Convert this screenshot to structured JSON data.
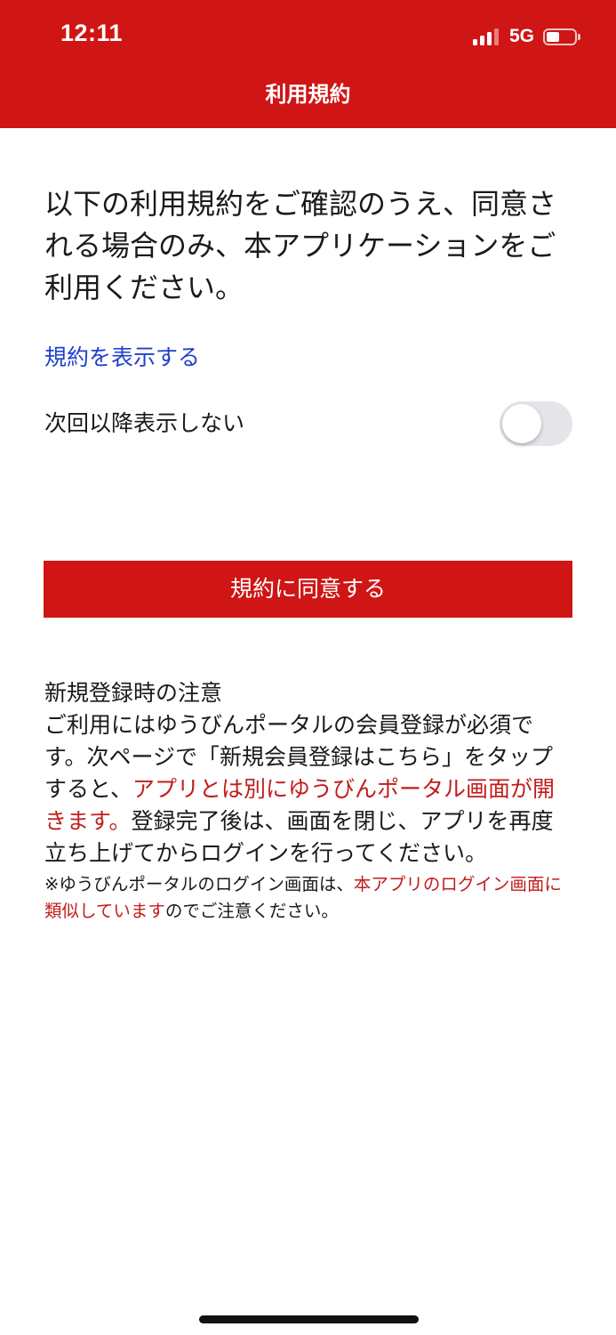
{
  "status_bar": {
    "time": "12:11",
    "network": "5G",
    "signal_bars": 3,
    "signal_bars_total": 4
  },
  "nav": {
    "title": "利用規約"
  },
  "intro_text": "以下の利用規約をご確認のうえ、同意される場合のみ、本アプリケーションをご利用ください。",
  "terms_link": "規約を表示する",
  "dont_show_again": {
    "label": "次回以降表示しない",
    "enabled": false
  },
  "agree_button": "規約に同意する",
  "notice": {
    "title": "新規登録時の注意",
    "body_1": "ご利用にはゆうびんポータルの会員登録が必須です。次ページで「新規会員登録はこちら」をタップすると、",
    "body_red": "アプリとは別にゆうびんポータル画面が開きます。",
    "body_2": "登録完了後は、画面を閉じ、アプリを再度立ち上げてからログインを行ってください。",
    "note_1": "※ゆうびんポータルのログイン画面は、",
    "note_red": "本アプリのログイン画面に類似しています",
    "note_2": "のでご注意ください。"
  },
  "colors": {
    "brand_red": "#d01515",
    "link_blue": "#1f3fd0",
    "emphasis_red": "#c21d1d",
    "toggle_off": "#e4e4e9"
  }
}
